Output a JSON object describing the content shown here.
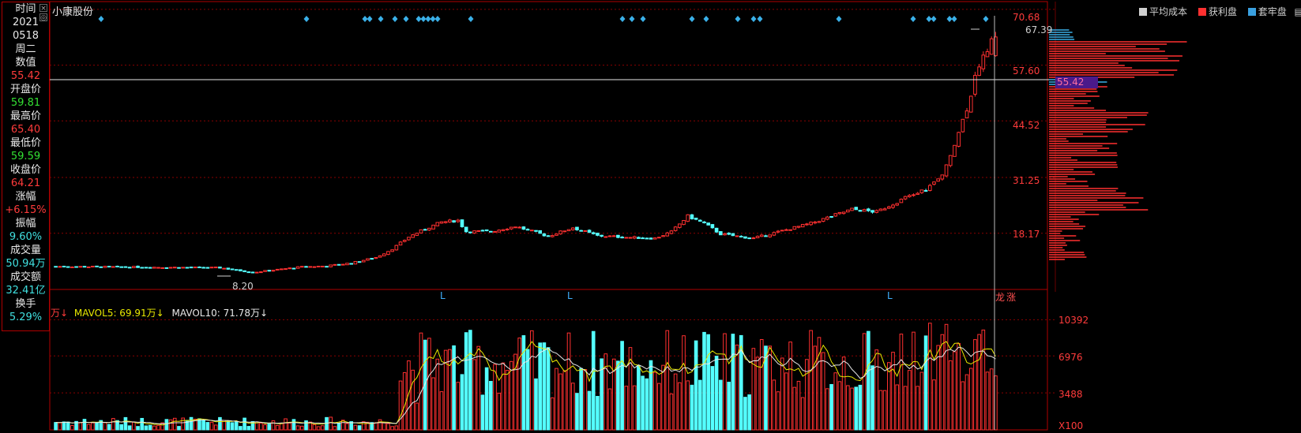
{
  "stock_name": "小康股份",
  "info_panel": {
    "rows": [
      {
        "label": "时间",
        "value": "2021"
      },
      {
        "label": "",
        "value": "0518"
      },
      {
        "label": "",
        "value": "周二"
      },
      {
        "label": "数值",
        "value": "55.42"
      },
      {
        "label": "开盘价",
        "value": "59.81"
      },
      {
        "label": "最高价",
        "value": "65.40"
      },
      {
        "label": "最低价",
        "value": "59.59"
      },
      {
        "label": "收盘价",
        "value": "64.21"
      },
      {
        "label": "涨幅",
        "value": "+6.15%"
      },
      {
        "label": "振幅",
        "value": "9.60%"
      },
      {
        "label": "成交量",
        "value": "50.94万"
      },
      {
        "label": "成交额",
        "value": "32.41亿"
      },
      {
        "label": "换手",
        "value": "5.29%"
      }
    ],
    "close_icon": "×",
    "settings_icon": "◎"
  },
  "legend": {
    "avg_cost": "平均成本",
    "profit": "获利盘",
    "trapped": "套牢盘",
    "avg_color": "#d0d0d0",
    "profit_color": "#ff3030",
    "trapped_color": "#3aa0e0"
  },
  "price_axis": [
    "70.68",
    "57.60",
    "44.52",
    "31.25",
    "18.17"
  ],
  "current_price": "55.42",
  "high_label": "67.39",
  "low_label": "8.20",
  "volume_axis": [
    "10392",
    "6976",
    "3488",
    "X100"
  ],
  "volume_header": {
    "unit_prefix": "万↓",
    "mavol5_label": "MAVOL5: 69.91万↓",
    "mavol10_label": "MAVOL10: 71.78万↓"
  },
  "markers": [
    "L",
    "L",
    "L"
  ],
  "notes": {
    "lhb": "龙",
    "zhang": "涨"
  },
  "colors": {
    "up": "#ff3030",
    "down": "#54ffff",
    "grid": "#8a0000",
    "border": "#b00000",
    "mavol5": "#e8e800",
    "mavol10": "#e8e8e8",
    "diamond": "#3ab0e8"
  },
  "chart_data": {
    "type": "candlestick",
    "ylim": [
      5.0,
      72.5
    ],
    "volume_ylim": [
      0,
      11500
    ],
    "candles": []
  }
}
